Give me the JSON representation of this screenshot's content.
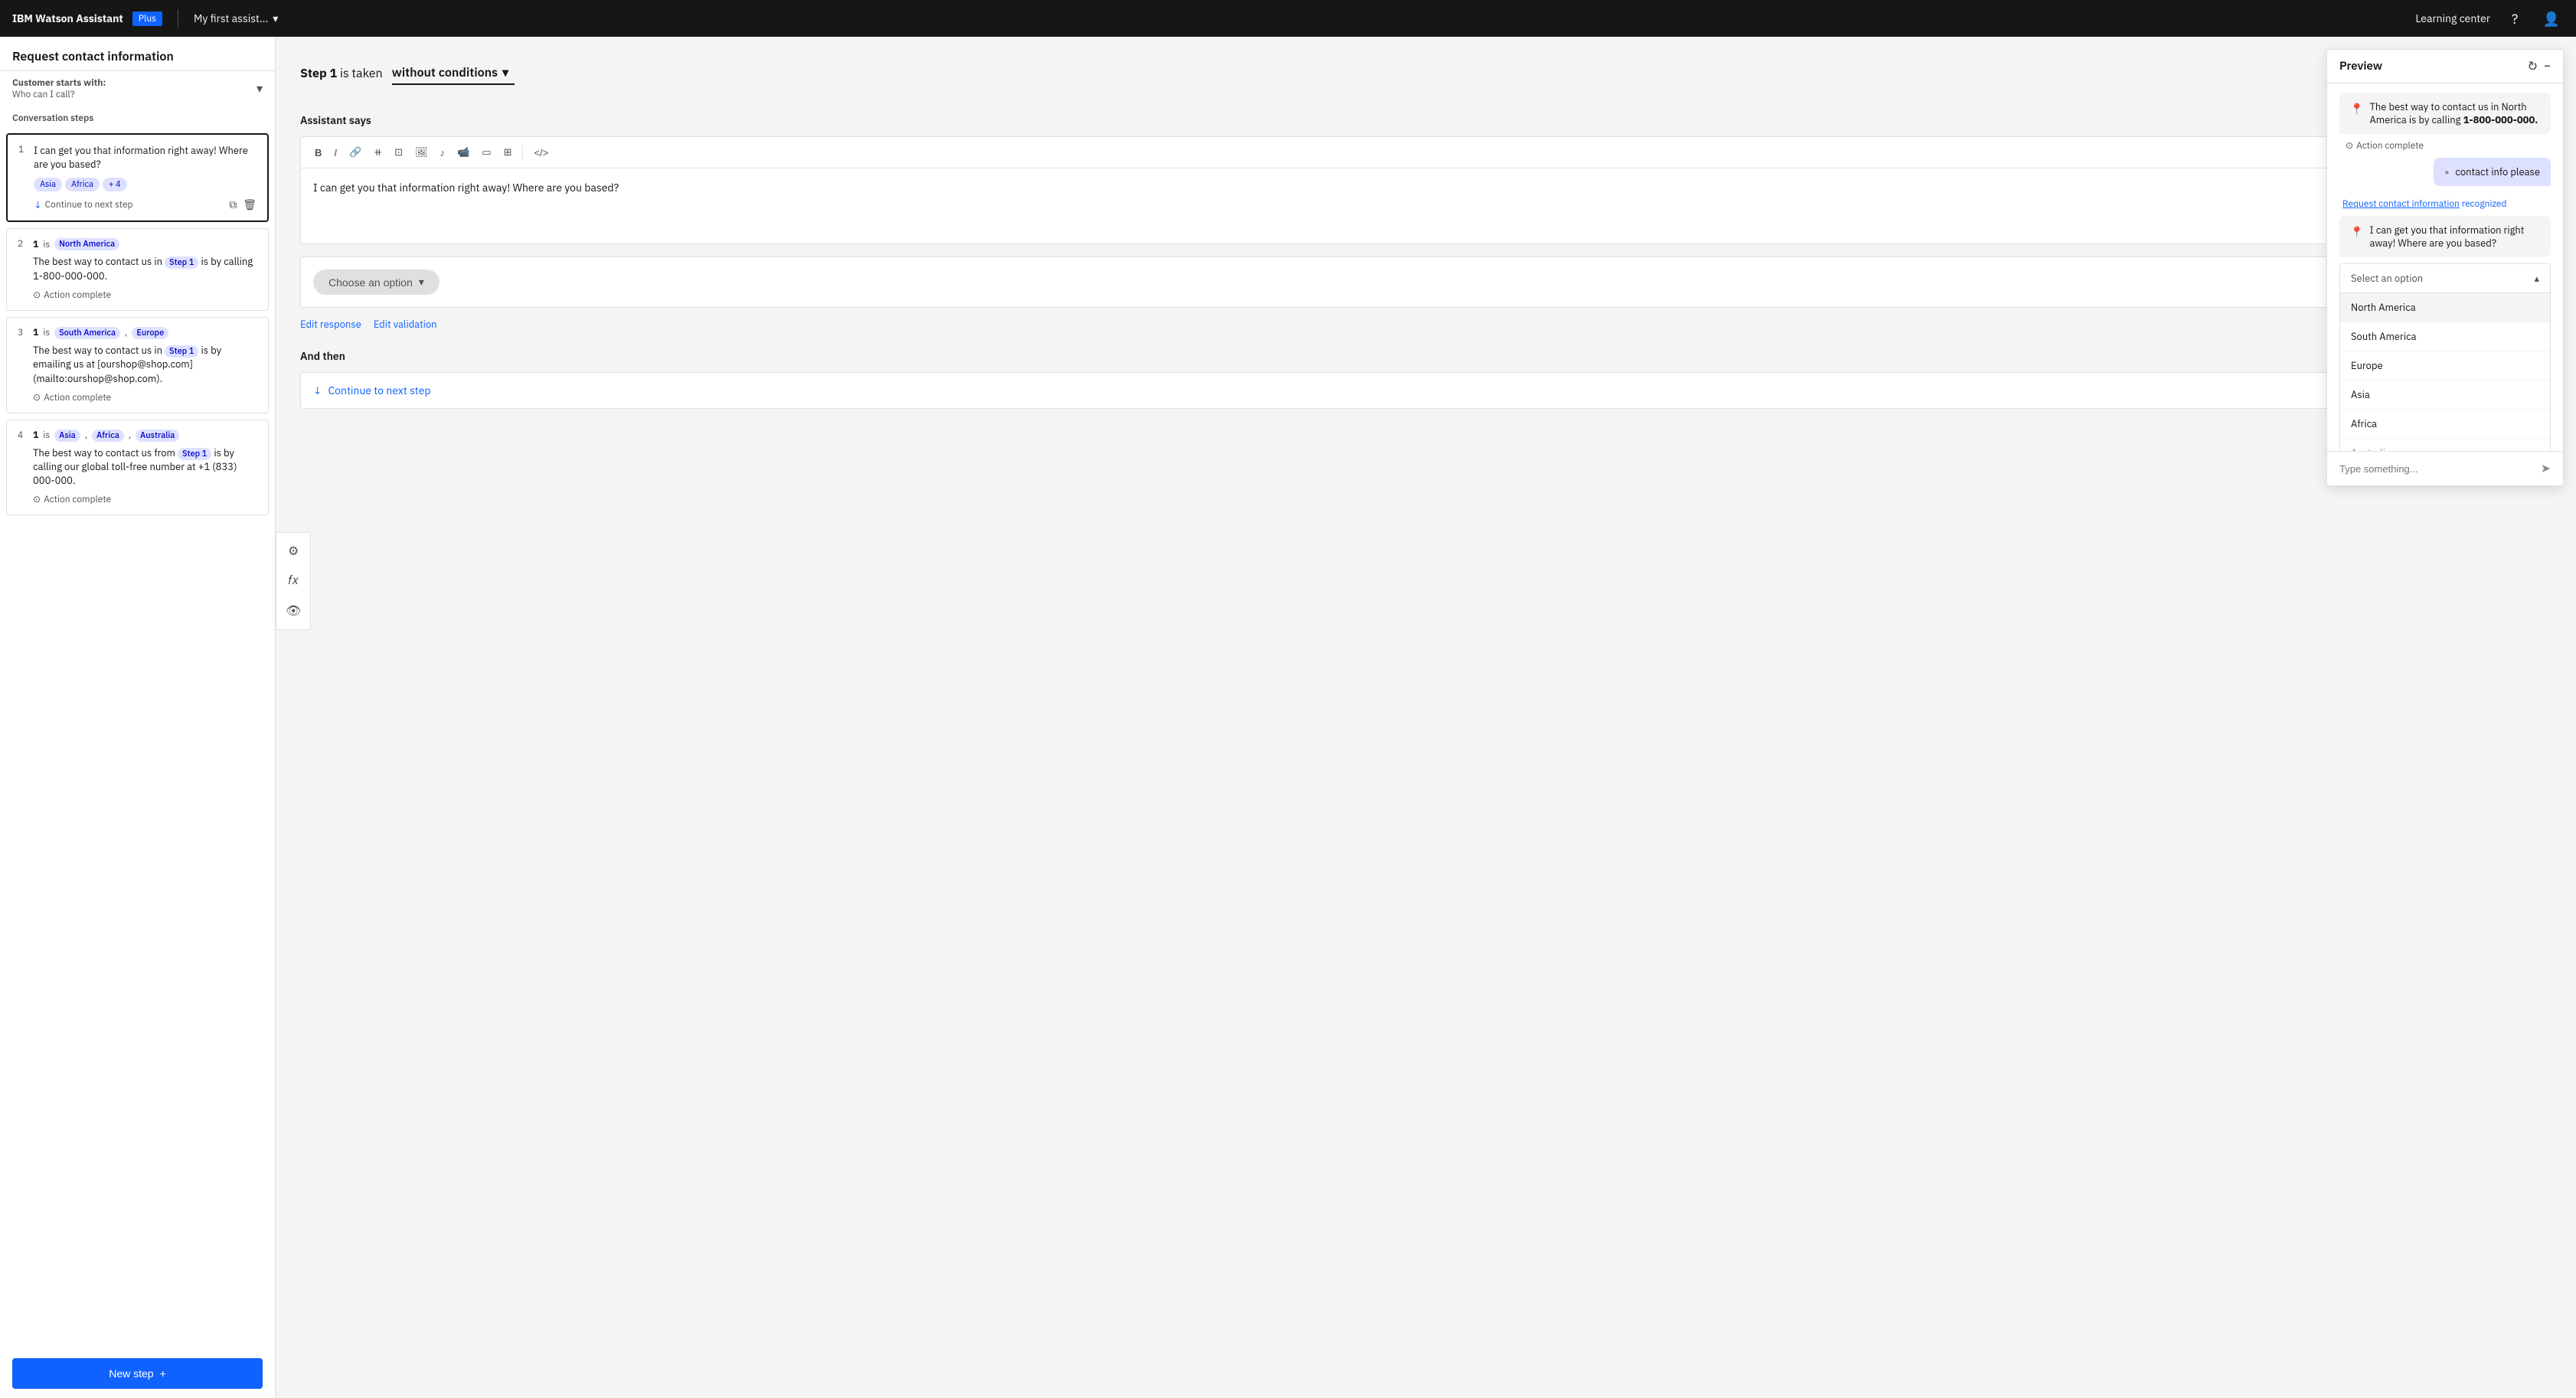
{
  "app": {
    "brand": "IBM Watson Assistant",
    "plan": "Plus",
    "nav_title": "My first assist...",
    "learning_center": "Learning center"
  },
  "sidebar": {
    "title": "Request contact information",
    "customer_starts_with": "Customer starts with:",
    "who_can_i_call": "Who can I call?",
    "conversation_steps_label": "Conversation steps",
    "steps": [
      {
        "number": "1",
        "active": true,
        "content": "I can get you that information right away! Where are you based?",
        "tags": [
          "Asia",
          "Africa",
          "+4"
        ],
        "footer": "Continue to next step"
      },
      {
        "number": "1",
        "condition_is": "is",
        "condition_tag": "North America",
        "content": "The best way to contact us in Step 1 is by calling 1-800-000-000.",
        "action_complete": "Action complete"
      },
      {
        "number": "1",
        "condition_is": "is",
        "condition_tags": [
          "South America",
          "Europe"
        ],
        "content": "The best way to contact us in Step 1 is by emailing us at [ourshop@shop.com](mailto:ourshop@shop.com).",
        "action_complete": "Action complete"
      },
      {
        "number": "1",
        "condition_is": "is",
        "condition_tags": [
          "Asia",
          "Africa",
          "Australia"
        ],
        "content": "The best way to contact us from Step 1 is by calling our global toll-free number at +1 (833) 000-000.",
        "action_complete": "Action complete"
      }
    ],
    "new_step_label": "New step"
  },
  "main": {
    "step_label": "Step 1",
    "is_taken": "is taken",
    "without_conditions": "without conditions",
    "assistant_says_label": "Assistant says",
    "editor_content": "I can get you that information right away! Where are you based?",
    "choose_option": "Choose an option",
    "edit_response": "Edit response",
    "edit_validation": "Edit validation",
    "and_then_label": "And then",
    "continue_to_next_step": "Continue to next step",
    "fx_label": "fx"
  },
  "preview": {
    "title": "Preview",
    "chat": [
      {
        "type": "assistant",
        "text": "The best way to contact us in North America is by calling 1-800-000-000.",
        "bold_part": "1-800-000-000."
      }
    ],
    "action_complete": "Action complete",
    "user_message": "contact info please",
    "recognized_label": "Request contact information",
    "recognized_suffix": "recognized",
    "second_assistant_message": "I can get you that information right away! Where are you based?",
    "select_an_option": "Select an option",
    "dropdown_options": [
      "North America",
      "South America",
      "Europe",
      "Asia",
      "Africa",
      "Australia"
    ],
    "type_placeholder": "Type something..."
  },
  "toolbar": {
    "bold": "B",
    "italic": "I",
    "link": "🔗",
    "icons": [
      "B",
      "I",
      "⛓",
      "⧺",
      "⊡",
      "🖼",
      "♪",
      "📹",
      "⬛",
      "⊞",
      "</>"
    ]
  }
}
